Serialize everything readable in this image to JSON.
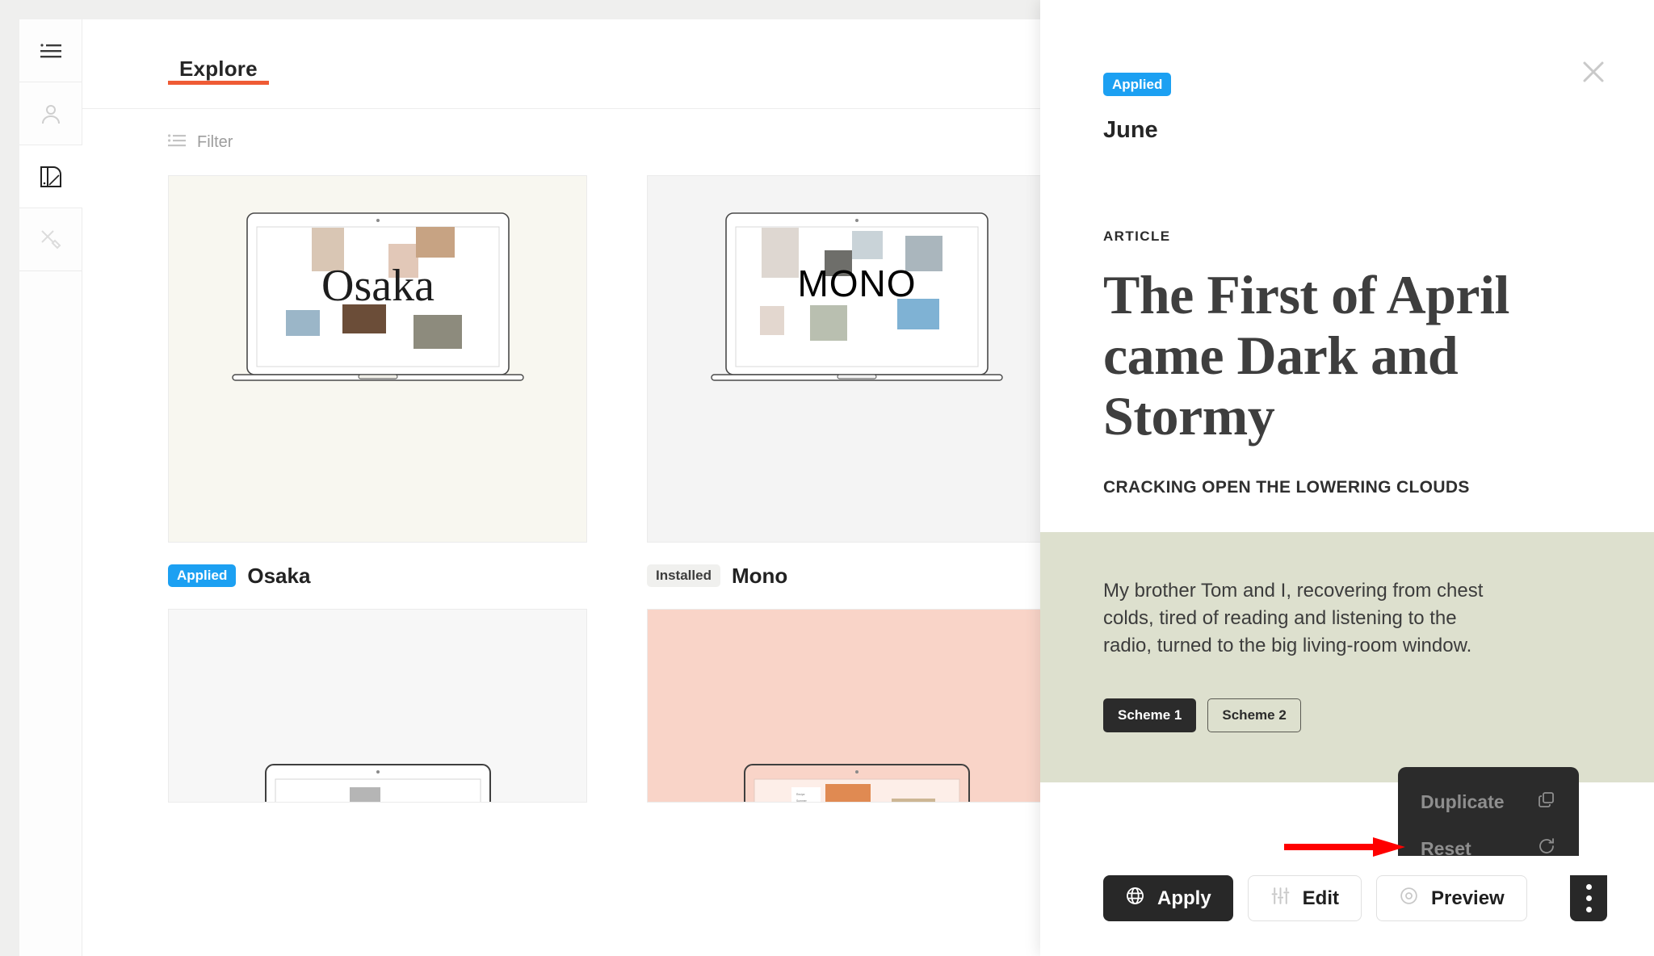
{
  "theme": {
    "accent": "#ef5b35",
    "applied_badge_color": "#1ca0f2",
    "scheme_bg": "#dde0ce",
    "dark": "#282828"
  },
  "sidebar": {
    "items": [
      {
        "name": "menu",
        "icon": "hamburger-list-icon",
        "active": false
      },
      {
        "name": "account",
        "icon": "user-icon",
        "active": false
      },
      {
        "name": "themes",
        "icon": "swatch-palette-icon",
        "active": true
      },
      {
        "name": "design-tools",
        "icon": "pen-ruler-icon",
        "active": false
      }
    ]
  },
  "main": {
    "tabs": [
      {
        "label": "Explore",
        "active": true
      }
    ],
    "filter": {
      "label": "Filter",
      "icon": "filter-list-icon"
    },
    "cards": [
      {
        "name": "Osaka",
        "badge": "Applied",
        "badge_type": "applied",
        "wordmark": "Osaka",
        "thumb_class": "cream"
      },
      {
        "name": "Mono",
        "badge": "Installed",
        "badge_type": "installed",
        "wordmark": "MONO",
        "thumb_class": "grey"
      },
      {
        "name": "",
        "badge": "",
        "badge_type": "",
        "wordmark": "",
        "thumb_class": "lgrey"
      },
      {
        "name": "",
        "badge": "",
        "badge_type": "",
        "wordmark": "",
        "thumb_class": "lgrey"
      },
      {
        "name": "",
        "badge": "",
        "badge_type": "",
        "wordmark": "",
        "thumb_class": "pink"
      }
    ]
  },
  "drawer": {
    "close_label": "×",
    "badge": "Applied",
    "title": "June",
    "kicker": "ARTICLE",
    "headline": "The First of April came Dark and Stormy",
    "subhead": "CRACKING OPEN THE LOWERING CLOUDS",
    "body": "My brother Tom and I, recovering from chest colds, tired of reading and listening to the radio, turned to the big living-room window.",
    "schemes": [
      {
        "label": "Scheme 1",
        "selected": true
      },
      {
        "label": "Scheme 2",
        "selected": false
      }
    ],
    "actions": [
      {
        "label": "Apply",
        "icon": "globe-icon",
        "style": "dark"
      },
      {
        "label": "Edit",
        "icon": "sliders-icon",
        "style": "light"
      },
      {
        "label": "Preview",
        "icon": "eye-icon",
        "style": "light"
      }
    ],
    "kebab": {
      "icon": "more-vertical-icon"
    },
    "context_menu": [
      {
        "label": "Duplicate",
        "icon": "copy-icon"
      },
      {
        "label": "Reset",
        "icon": "refresh-icon"
      }
    ]
  },
  "annotation": {
    "arrow": "red-arrow-pointing-right-at-reset"
  }
}
